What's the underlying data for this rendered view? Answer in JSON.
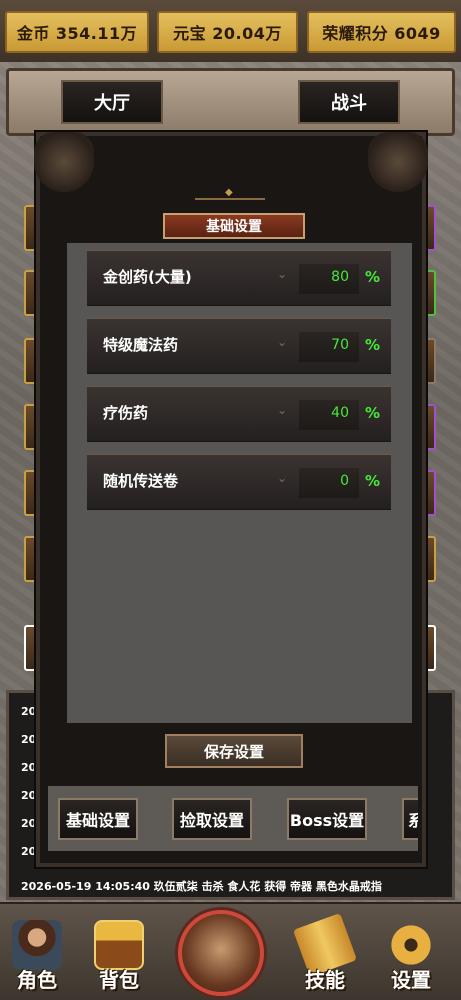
{
  "currency": {
    "gold": "金币 354.11万",
    "yuanbao": "元宝 20.04万",
    "honor": "荣耀积分 6049"
  },
  "tabs": {
    "hall": "大厅",
    "battle": "战斗"
  },
  "dialog": {
    "title": "基础设置",
    "rows": [
      {
        "label": "金创药(大量)",
        "value": "80",
        "unit": "%"
      },
      {
        "label": "特级魔法药",
        "value": "70",
        "unit": "%"
      },
      {
        "label": "疗伤药",
        "value": "40",
        "unit": "%"
      },
      {
        "label": "随机传送卷",
        "value": "0",
        "unit": "%"
      }
    ],
    "save_label": "保存设置",
    "subtabs": [
      "基础设置",
      "捡取设置",
      "Boss设置",
      "系"
    ]
  },
  "log": {
    "prefixes": [
      "202",
      "202",
      "202",
      "202",
      "202",
      "202",
      "202"
    ],
    "last_line": "2026-05-19 14:05:40 玖伍贰柒 击杀 食人花 获得 帝器 黑色水晶戒指"
  },
  "bottom_nav": {
    "items": [
      {
        "label": "角色",
        "icon": "character-icon"
      },
      {
        "label": "背包",
        "icon": "treasure-chest-icon"
      },
      {
        "label": "",
        "icon": "hero-portrait-icon"
      },
      {
        "label": "技能",
        "icon": "scroll-icon"
      },
      {
        "label": "设置",
        "icon": "gear-icon"
      }
    ]
  },
  "colors": {
    "accent_gold": "#e4bf5e",
    "value_green": "#46e83a",
    "title_red": "#8a3a22"
  }
}
